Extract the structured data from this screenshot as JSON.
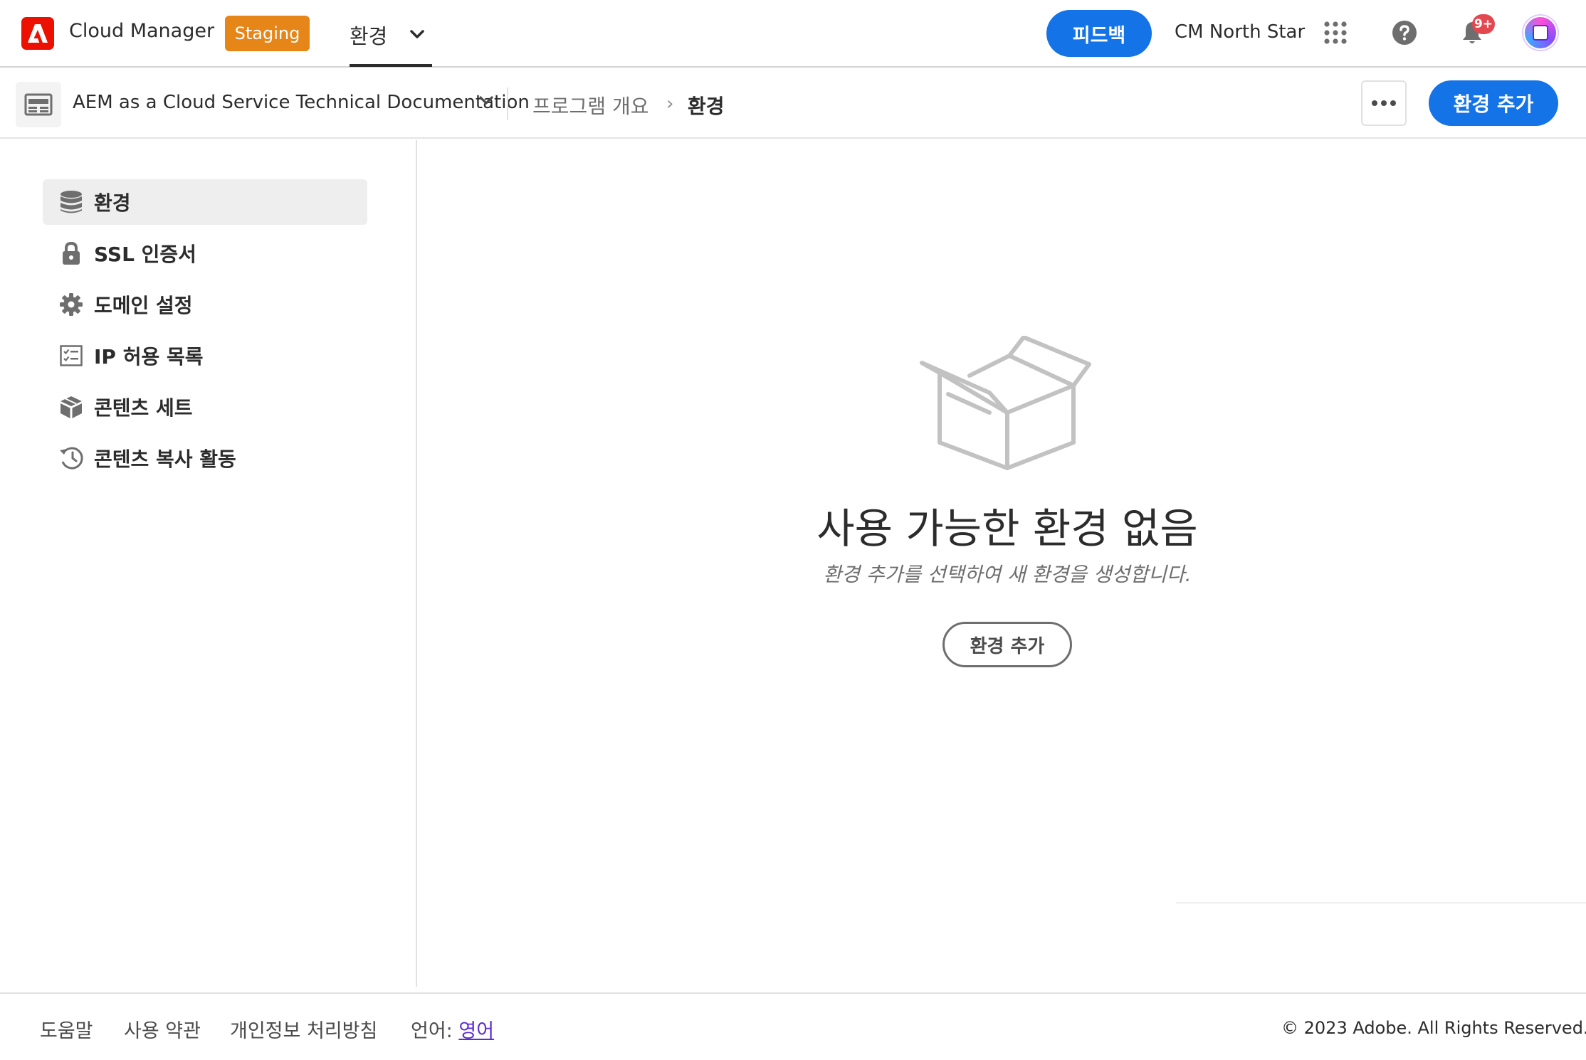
{
  "header": {
    "logo_icon": "adobe-logo-icon",
    "app_name": "Cloud Manager",
    "env_badge": "Staging",
    "env_switcher_label": "환경",
    "feedback_label": "피드백",
    "org_name": "CM North Star",
    "notification_count": "9+",
    "colors": {
      "brand": "#eb1000",
      "accent": "#1473e6",
      "staging": "#e68619",
      "badge": "#e34850"
    }
  },
  "subheader": {
    "program_name": "AEM as a Cloud Service Technical Documentation",
    "breadcrumb_parent": "프로그램 개요",
    "breadcrumb_separator": "›",
    "breadcrumb_current": "환경",
    "add_environment_label": "환경 추가"
  },
  "sidebar": {
    "items": [
      {
        "label": "환경",
        "icon": "database-icon",
        "active": true
      },
      {
        "label": "SSL 인증서",
        "icon": "lock-icon",
        "active": false
      },
      {
        "label": "도메인 설정",
        "icon": "gear-icon",
        "active": false
      },
      {
        "label": "IP 허용 목록",
        "icon": "checklist-icon",
        "active": false
      },
      {
        "label": "콘텐츠 세트",
        "icon": "box-icon",
        "active": false
      },
      {
        "label": "콘텐츠 복사 활동",
        "icon": "history-icon",
        "active": false
      }
    ]
  },
  "main": {
    "empty_icon": "empty-box-icon",
    "empty_title": "사용 가능한 환경 없음",
    "empty_description": "환경 추가를 선택하여 새 환경을 생성합니다.",
    "empty_button_label": "환경 추가"
  },
  "footer": {
    "help": "도움말",
    "terms": "사용 약관",
    "privacy": "개인정보 처리방침",
    "language_label": "언어:",
    "language_value": "영어",
    "copyright": "© 2023 Adobe. All Rights Reserved."
  }
}
